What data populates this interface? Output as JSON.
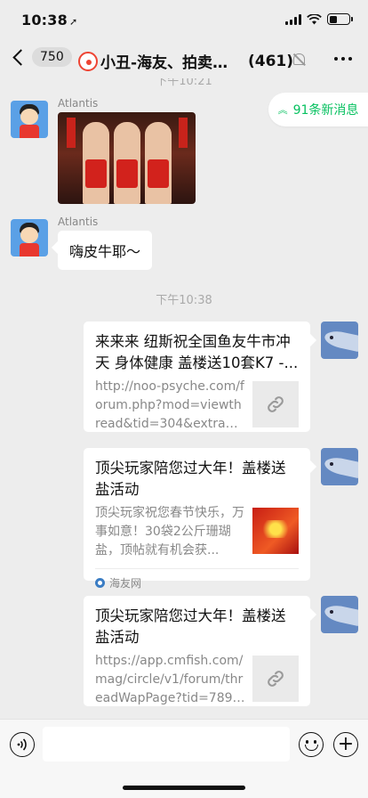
{
  "status_bar": {
    "time": "10:38",
    "location_glyph": "➚"
  },
  "header": {
    "unread_count": "750",
    "chat_name": "小丑-海友、拍卖交...",
    "member_count": "(461)"
  },
  "chat": {
    "partial_timestamp": "下午10:21",
    "new_messages_label": "91条新消息",
    "timestamp": "下午10:38",
    "messages": [
      {
        "sender": "Atlantis",
        "type": "image"
      },
      {
        "sender": "Atlantis",
        "type": "text",
        "text": "嗨皮牛耶～"
      }
    ],
    "cards": [
      {
        "title": "来来来 纽斯祝全国鱼友牛市冲天 身体健康 盖楼送10套K7 -...",
        "desc": "http://noo-psyche.com/forum.php?mod=viewthread&tid=304&extra=page...",
        "thumb": "link-icon"
      },
      {
        "title": "顶尖玩家陪您过大年！盖楼送盐活动",
        "desc": "顶尖玩家祝您春节快乐，万事如意！30袋2公斤珊瑚盐，顶帖就有机会获...",
        "thumb": "image",
        "source": "海友网"
      },
      {
        "title": "顶尖玩家陪您过大年！盖楼送盐活动",
        "desc": "https://app.cmfish.com/mag/circle/v1/forum/threadWapPage?tid=789848...",
        "thumb": "link-icon"
      }
    ]
  },
  "colors": {
    "accent_green": "#07c160",
    "background": "#ededed"
  }
}
